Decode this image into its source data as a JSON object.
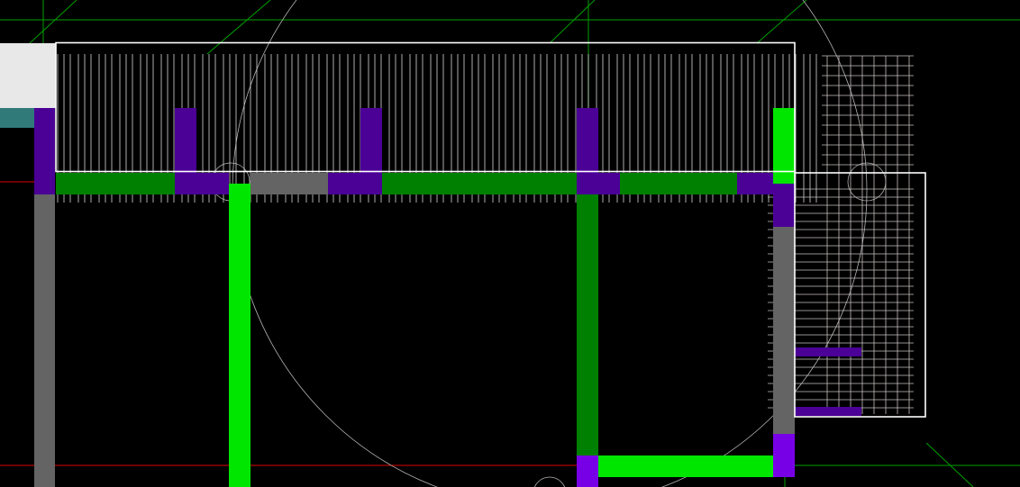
{
  "viewport": {
    "background": "#000000"
  },
  "palette": {
    "wall_bright": "#00e600",
    "wall_dark": "#008000",
    "wall_gray": "#646464",
    "column_purple": "#4b0096",
    "column_violet": "#7800e6",
    "panel_white": "#e8e8e8",
    "panel_teal": "#307a7a",
    "outline": "#ffffff",
    "hatch": "#d8d8d8",
    "grid_mesh": "#c8c0c0",
    "guide_green": "#00a000",
    "guide_red": "#dc0000",
    "arc": "#b4b4b4"
  },
  "layers": [
    "guide-lines",
    "arc-circles",
    "hatch-region",
    "wall-segments",
    "column-blocks",
    "mesh-grid",
    "outlines"
  ]
}
